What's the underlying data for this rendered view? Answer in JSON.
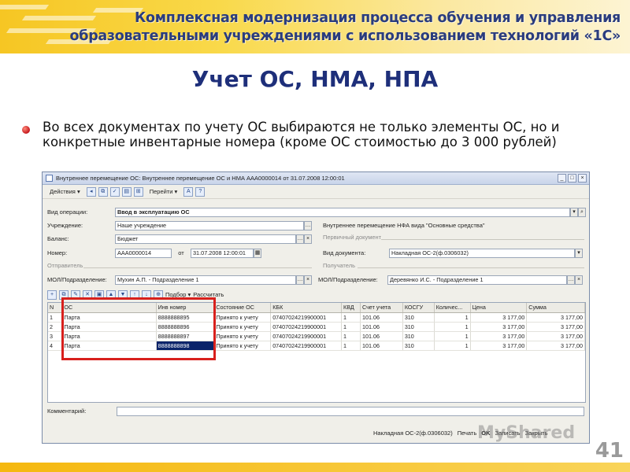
{
  "banner": {
    "line1": "Комплексная модернизация процесса обучения и управления",
    "line2": "образовательными учреждениями с использованием технологий «1С»"
  },
  "slide": {
    "title": "Учет ОС, НМА, НПА",
    "bullet": "Во всех документах по учету ОС выбираются не только элементы ОС, но и конкретные инвентарные номера (кроме ОС стоимостью до 3 000 рублей)",
    "page_number": "41",
    "watermark": "MyShared"
  },
  "window": {
    "title": "Внутреннее перемещение ОС: Внутреннее перемещение ОС и НМА ААА0000014 от 31.07.2008 12:00:01",
    "toolbar": {
      "actions": "Действия",
      "goto": "Перейти",
      "help": "?"
    },
    "form": {
      "operation_label": "Вид операции:",
      "operation_value": "Ввод в эксплуатацию ОС",
      "institution_label": "Учреждение:",
      "institution_value": "Наше учреждение",
      "balance_label": "Баланс:",
      "balance_value": "Бюджет",
      "number_label": "Номер:",
      "number_value": "ААА0000014",
      "date_from_label": "от",
      "date_value": "31.07.2008 12:00:01",
      "nfa_note": "Внутреннее перемещение НФА вида \"Основные средства\"",
      "primary_doc_section": "Первичный документ",
      "doc_type_label": "Вид документа:",
      "doc_type_value": "Накладная ОС-2(ф.0306032)",
      "sender_section": "Отправитель",
      "sender_mol_label": "МОЛ/Подразделение:",
      "sender_mol_value": "Мухин А.П. - Подразделение 1",
      "receiver_section": "Получатель",
      "receiver_mol_label": "МОЛ/Подразделение:",
      "receiver_mol_value": "Деревянко И.С. - Подразделение 1",
      "select_button": "Подбор",
      "calc_button": "Рассчитать",
      "comment_label": "Комментарий:"
    },
    "table": {
      "columns": [
        "N",
        "ОС",
        "Инв номер",
        "Состояние ОС",
        "КБК",
        "КВД",
        "Счет учета",
        "КОСГУ",
        "Количес...",
        "Цена",
        "Сумма"
      ],
      "rows": [
        [
          "1",
          "Парта",
          "8888888895",
          "Принято к учету",
          "07407024219900001",
          "1",
          "101.06",
          "310",
          "1",
          "3 177,00",
          "3 177,00"
        ],
        [
          "2",
          "Парта",
          "8888888896",
          "Принято к учету",
          "07407024219900001",
          "1",
          "101.06",
          "310",
          "1",
          "3 177,00",
          "3 177,00"
        ],
        [
          "3",
          "Парта",
          "8888888897",
          "Принято к учету",
          "07407024219900001",
          "1",
          "101.06",
          "310",
          "1",
          "3 177,00",
          "3 177,00"
        ],
        [
          "4",
          "Парта",
          "8888888898",
          "Принято к учету",
          "07407024219900001",
          "1",
          "101.06",
          "310",
          "1",
          "3 177,00",
          "3 177,00"
        ]
      ]
    },
    "bottom": {
      "print_form": "Накладная ОС-2(ф.0306032)",
      "print": "Печать",
      "ok": "OK",
      "save": "Записать",
      "close": "Закрыть"
    }
  }
}
